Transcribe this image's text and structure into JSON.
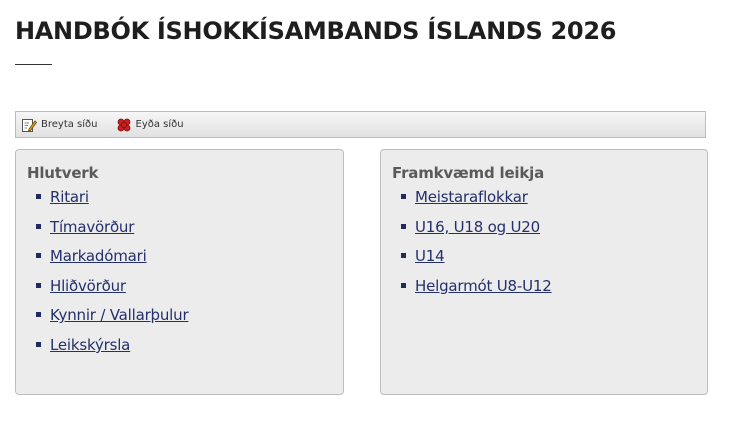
{
  "page": {
    "title": "HANDBÓK ÍSHOKKÍSAMBANDS ÍSLANDS 2026"
  },
  "toolbar": {
    "edit_label": "Breyta síðu",
    "delete_label": "Eyða síðu",
    "edit_icon": "edit-page-icon",
    "delete_icon": "delete-page-icon"
  },
  "panels": [
    {
      "heading": "Hlutverk",
      "links": [
        "Ritari",
        "Tímavörður",
        "Markadómari",
        "Hliðvörður",
        "Kynnir / Vallarþulur",
        "Leikskýrsla"
      ]
    },
    {
      "heading": "Framkvæmd leikja",
      "links": [
        "Meistaraflokkar",
        "U16, U18 og U20",
        "U14",
        "Helgarmót U8-U12"
      ]
    }
  ],
  "colors": {
    "link": "#23306b",
    "bullet": "#1f2a5e",
    "panel_bg": "#ececec",
    "heading": "#5a5a5a"
  }
}
